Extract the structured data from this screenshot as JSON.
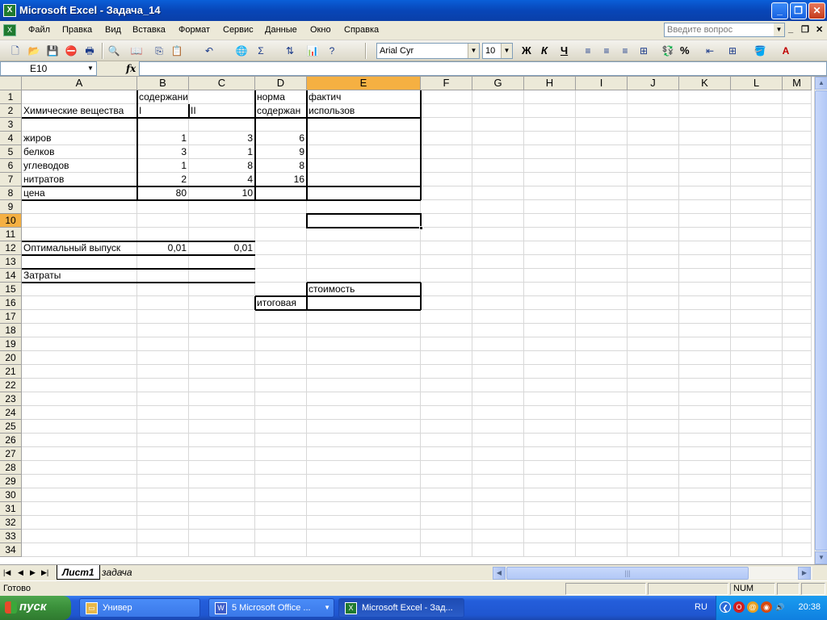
{
  "window": {
    "title": "Microsoft Excel - Задача_14",
    "icon": "excel-icon"
  },
  "menu": {
    "items": [
      "Файл",
      "Правка",
      "Вид",
      "Вставка",
      "Формат",
      "Сервис",
      "Данные",
      "Окно",
      "Справка"
    ],
    "help_placeholder": "Введите вопрос"
  },
  "toolbar": {
    "font": "Arial Cyr",
    "font_size": "10",
    "bold": "Ж",
    "italic": "К",
    "underline": "Ч",
    "percent": "%"
  },
  "formula_bar": {
    "name_box": "E10",
    "fx": "fx",
    "value": ""
  },
  "sheet": {
    "columns": [
      "A",
      "B",
      "C",
      "D",
      "E",
      "F",
      "G",
      "H",
      "I",
      "J",
      "K",
      "L",
      "M"
    ],
    "selected_column": "E",
    "selected_row": "10",
    "rows": [
      "1",
      "2",
      "3",
      "4",
      "5",
      "6",
      "7",
      "8",
      "9",
      "10",
      "11",
      "12",
      "13",
      "14",
      "15",
      "16",
      "17",
      "18",
      "19",
      "20",
      "21",
      "22",
      "23",
      "24",
      "25",
      "26",
      "27",
      "28",
      "29",
      "30",
      "31",
      "32",
      "33",
      "34"
    ],
    "cells": {
      "B1": "содержание пит.вещ-в",
      "D1": "норма",
      "E1": "фактич",
      "A2": "Химические вещества",
      "B2": "I",
      "C2": "II",
      "D2": "содержан",
      "E2": "использов",
      "A4": "жиров",
      "B4": "1",
      "C4": "3",
      "D4": "6",
      "A5": "белков",
      "B5": "3",
      "C5": "1",
      "D5": "9",
      "A6": "углеводов",
      "B6": "1",
      "C6": "8",
      "D6": "8",
      "A7": "нитратов",
      "B7": "2",
      "C7": "4",
      "D7": "16",
      "A8": "цена",
      "B8": "80",
      "C8": "10",
      "A12": "Оптимальный выпуск",
      "B12": "0,01",
      "C12": "0,01",
      "A14": "Затраты",
      "E15": "стоимость",
      "D16": "итоговая"
    }
  },
  "tabs": {
    "sheets": [
      "Лист1",
      "задача"
    ],
    "active": "Лист1"
  },
  "status": {
    "text": "Готово",
    "num": "NUM"
  },
  "taskbar": {
    "start": "пуск",
    "tasks": [
      "Универ",
      "5 Microsoft Office ...",
      "Microsoft Excel - Зад..."
    ],
    "lang": "RU",
    "clock": "20:38"
  }
}
